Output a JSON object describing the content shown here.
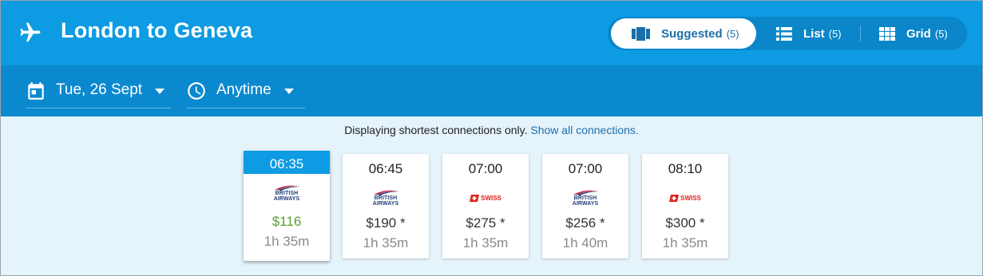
{
  "header": {
    "title": "London to Geneva",
    "views": [
      {
        "label": "Suggested",
        "count": "(5)",
        "icon": "cards-icon",
        "active": true
      },
      {
        "label": "List",
        "count": "(5)",
        "icon": "list-icon",
        "active": false
      },
      {
        "label": "Grid",
        "count": "(5)",
        "icon": "grid-icon",
        "active": false
      }
    ]
  },
  "filters": {
    "date": "Tue, 26 Sept",
    "time": "Anytime"
  },
  "notice": {
    "text": "Displaying shortest connections only.",
    "link": "Show all connections."
  },
  "flights": [
    {
      "time": "06:35",
      "airline_logo_text": [
        "BRITISH",
        "AIRWAYS"
      ],
      "price": "$116",
      "duration": "1h 35m",
      "selected": true
    },
    {
      "time": "06:45",
      "airline_logo_text": [
        "BRITISH",
        "AIRWAYS"
      ],
      "price": "$190 *",
      "duration": "1h 35m",
      "selected": false
    },
    {
      "time": "07:00",
      "airline_logo_text": [
        "SWISS"
      ],
      "price": "$275 *",
      "duration": "1h 35m",
      "selected": false
    },
    {
      "time": "07:00",
      "airline_logo_text": [
        "BRITISH",
        "AIRWAYS"
      ],
      "price": "$256 *",
      "duration": "1h 40m",
      "selected": false
    },
    {
      "time": "08:10",
      "airline_logo_text": [
        "SWISS"
      ],
      "price": "$300 *",
      "duration": "1h 35m",
      "selected": false
    }
  ],
  "colors": {
    "header_bg": "#0d9be3",
    "filter_bg": "#0a89cf",
    "content_bg": "#e5f3fb",
    "price_best": "#5a9f2a"
  }
}
